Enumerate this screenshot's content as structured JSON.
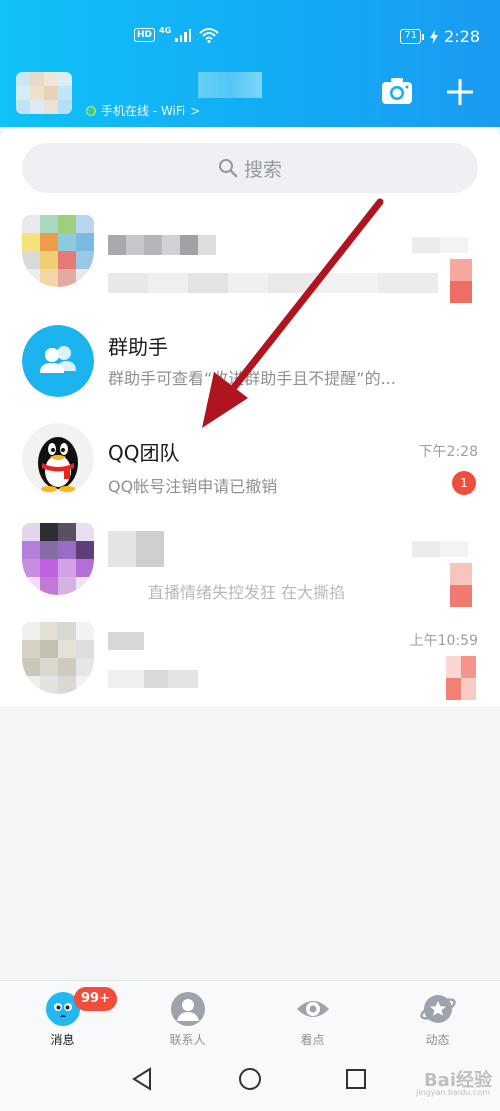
{
  "status_bar": {
    "network_badge": "HD",
    "network_type": "4G",
    "battery_level": "71",
    "time": "2:28"
  },
  "header": {
    "online_status": "手机在线 - WiFi",
    "online_chevron": ">",
    "icons": [
      "camera-icon",
      "plus-icon"
    ]
  },
  "search": {
    "placeholder": "搜索"
  },
  "messages": [
    {
      "title": "",
      "preview": "",
      "time": ""
    },
    {
      "title": "群助手",
      "preview": "群助手可查看“收进群助手且不提醒”的...",
      "time": ""
    },
    {
      "title": "QQ团队",
      "preview": "QQ帐号注销申请已撤销",
      "time": "下午2:28",
      "unread": "1"
    },
    {
      "title": "",
      "preview": "直播情绪失控发狂 在大撕掐",
      "time": ""
    },
    {
      "title": "",
      "preview": "",
      "time": "上午10:59"
    }
  ],
  "tabs": [
    {
      "label": "消息",
      "badge": "99+",
      "icon": "message-icon",
      "active": true
    },
    {
      "label": "联系人",
      "icon": "contacts-icon"
    },
    {
      "label": "看点",
      "icon": "eye-icon"
    },
    {
      "label": "动态",
      "icon": "star-planet-icon"
    }
  ],
  "watermark": {
    "text": "Bai经验",
    "sub": "jingyan.baidu.com"
  },
  "colors": {
    "header_start": "#10c2f7",
    "header_end": "#1a9bf2",
    "badge_red": "#f24c3a",
    "arrow_red": "#b0151f"
  }
}
